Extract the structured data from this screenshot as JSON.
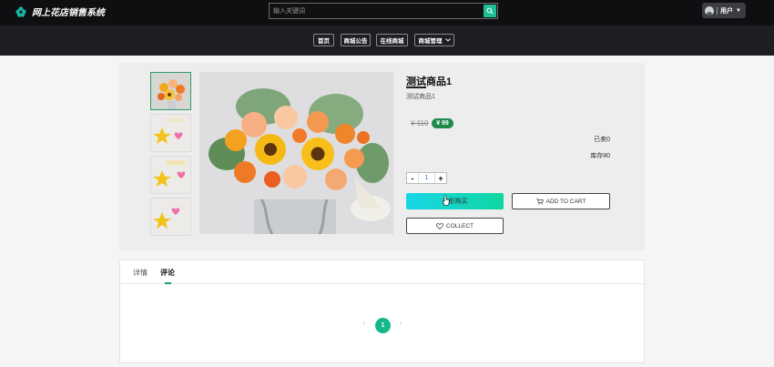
{
  "header": {
    "site_title": "网上花店销售系统",
    "search_placeholder": "输入关键词",
    "user_label": "用户"
  },
  "nav": {
    "items": [
      {
        "label": "首页"
      },
      {
        "label": "商城公告"
      },
      {
        "label": "在线商城"
      },
      {
        "label": "商城管理"
      }
    ]
  },
  "product": {
    "title": "测试商品1",
    "subtitle": "测试商品1",
    "old_price": "¥ 110",
    "price": "¥ 99",
    "sold": "已卖0",
    "stock": "库存80",
    "quantity": "1",
    "minus": "-",
    "plus": "+",
    "buy_label": "立即购买",
    "cart_label": "ADD TO CART",
    "collect_label": "COLLECT"
  },
  "tabs": [
    {
      "label": "详情"
    },
    {
      "label": "评论"
    }
  ],
  "pagination": {
    "prev": "‹",
    "current": "1",
    "next": "›"
  },
  "colors": {
    "accent": "#13b98a",
    "header_bg": "#0f0f12",
    "nav_bg": "#1c1e22",
    "price_badge": "#1f8a4c"
  }
}
